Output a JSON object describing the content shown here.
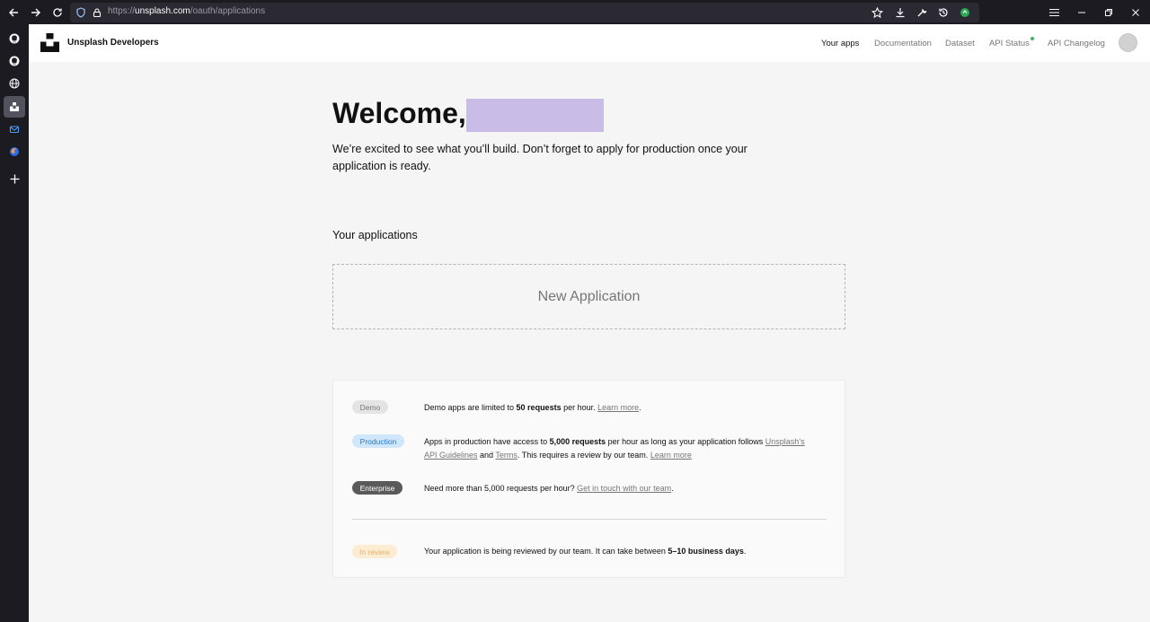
{
  "browser": {
    "url_prefix": "https://",
    "url_domain": "unsplash.com",
    "url_path": "/oauth/applications"
  },
  "header": {
    "brand": "Unsplash Developers",
    "nav": [
      "Your apps",
      "Documentation",
      "Dataset",
      "API Status",
      "API Changelog"
    ]
  },
  "main": {
    "welcome": "Welcome,",
    "intro": "We’re excited to see what you’ll build. Don’t forget to apply for production once your application is ready.",
    "apps_title": "Your applications",
    "new_app": "New Application"
  },
  "info": {
    "demo": {
      "badge": "Demo",
      "t1": "Demo apps are limited to ",
      "b1": "50 requests",
      "t2": " per hour. ",
      "link": "Learn more",
      "t3": "."
    },
    "production": {
      "badge": "Production",
      "t1": "Apps in production have access to ",
      "b1": "5,000 requests",
      "t2": " per hour as long as your application follows ",
      "link1": "Unsplash’s API Guidelines",
      "t3": " and ",
      "link2": "Terms",
      "t4": ". This requires a review by our team. ",
      "link3": "Learn more"
    },
    "enterprise": {
      "badge": "Enterprise",
      "t1": "Need more than 5,000 requests per hour? ",
      "link": "Get in touch with our team",
      "t2": "."
    },
    "review": {
      "badge": "In review",
      "t1": "Your application is being reviewed by our team. It can take between ",
      "b1": "5–10 business days",
      "t2": "."
    }
  },
  "colors": {
    "accent_status": "#3cb46e",
    "redaction": "#c9bde8",
    "production_badge": "#cfe6fb",
    "review_badge": "#fcecd2"
  }
}
